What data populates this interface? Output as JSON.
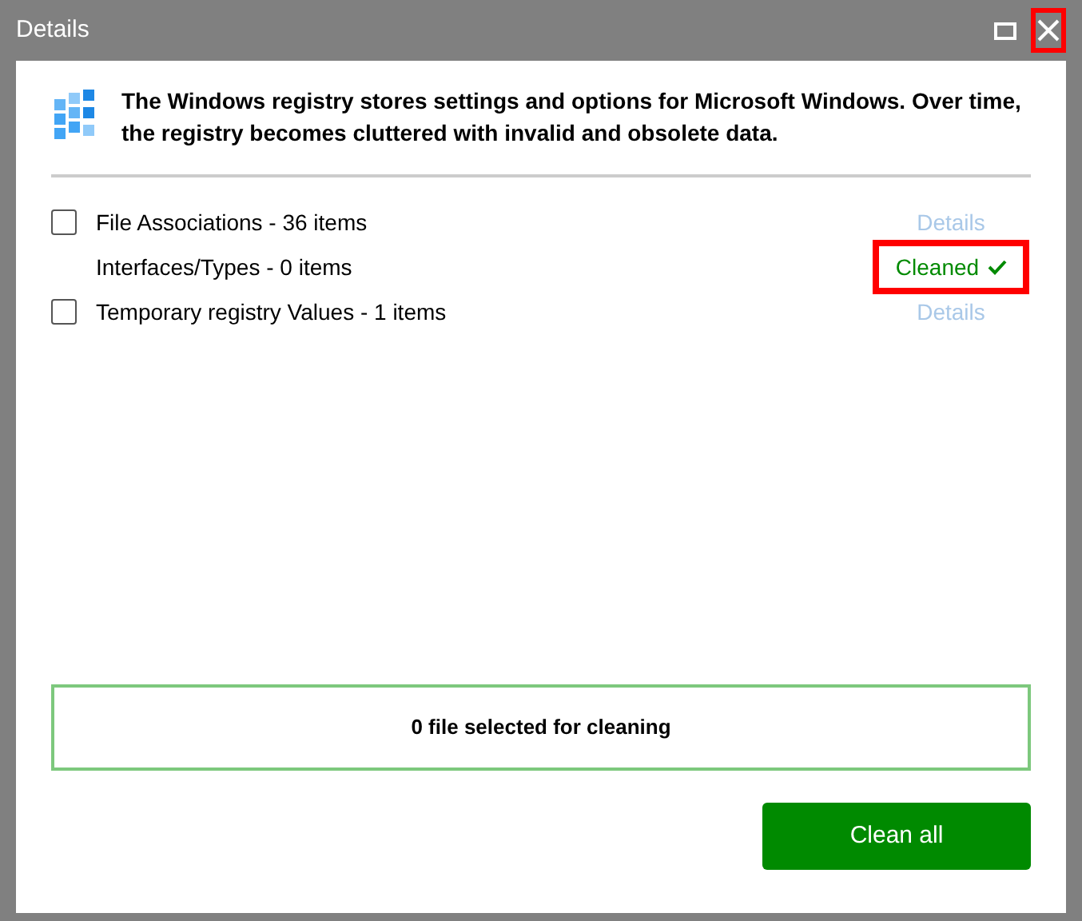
{
  "window": {
    "title": "Details",
    "close_highlighted": true
  },
  "intro": "The Windows registry stores settings and options for Microsoft Windows. Over time, the registry becomes cluttered with invalid and obsolete data.",
  "items": [
    {
      "kind": "checkbox",
      "label": "File Associations - 36 items",
      "checked": false,
      "action": "Details"
    },
    {
      "kind": "cleaned",
      "label": "Interfaces/Types - 0 items",
      "status": "Cleaned",
      "highlighted": true
    },
    {
      "kind": "checkbox",
      "label": "Temporary registry Values - 1 items",
      "checked": false,
      "action": "Details"
    }
  ],
  "summary": "0 file selected for cleaning",
  "button": "Clean all"
}
